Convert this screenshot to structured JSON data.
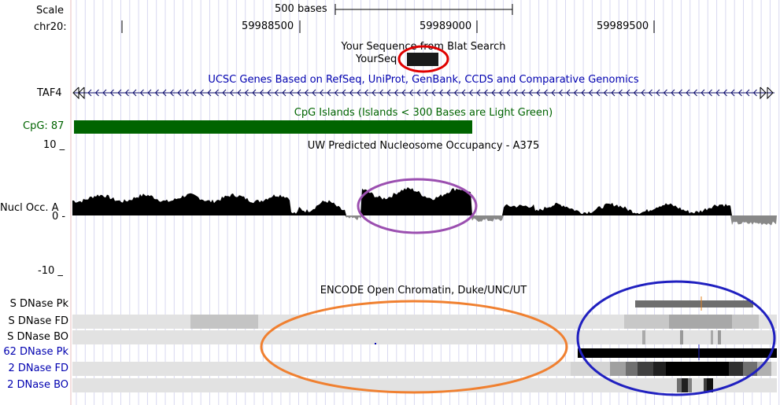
{
  "ruler": {
    "scale_label": "Scale",
    "scale_bar_text": "500 bases",
    "chrom_label": "chr20:",
    "ticks": [
      "59988500",
      "59989000",
      "59989500"
    ]
  },
  "tracks": {
    "blat": {
      "title": "Your Sequence from Blat Search",
      "item_label": "YourSeq"
    },
    "ucsc_genes": {
      "title": "UCSC Genes Based on RefSeq, UniProt, GenBank, CCDS and Comparative Genomics",
      "gene_name": "TAF4"
    },
    "cpg": {
      "title": "CpG Islands (Islands < 300 Bases are Light Green)",
      "item_label": "CpG: 87"
    },
    "nucleosome": {
      "title": "UW Predicted Nucleosome Occupancy - A375",
      "label": "Nucl Occ. A",
      "y_top": "10 _",
      "y_zero": "0 -",
      "y_bottom": "-10 _"
    },
    "encode": {
      "title": "ENCODE Open Chromatin, Duke/UNC/UT",
      "rows": [
        {
          "label": "S DNase Pk",
          "color": "#000000"
        },
        {
          "label": "S DNase FD",
          "color": "#000000"
        },
        {
          "label": "S DNase BO",
          "color": "#000000"
        },
        {
          "label": "62 DNase Pk",
          "color": "#0000b0"
        },
        {
          "label": "2 DNase FD",
          "color": "#0000b0"
        },
        {
          "label": "2 DNase BO",
          "color": "#0000b0"
        }
      ]
    }
  },
  "annotations": {
    "red_ellipse": "#e00000",
    "purple_ellipse": "#9b4fb0",
    "orange_ellipse": "#f08030",
    "blue_ellipse": "#2020c0"
  },
  "colors": {
    "cpg_bar": "#006400",
    "grid": "#d8d8f0",
    "density_bg": "#e2e2e2"
  }
}
